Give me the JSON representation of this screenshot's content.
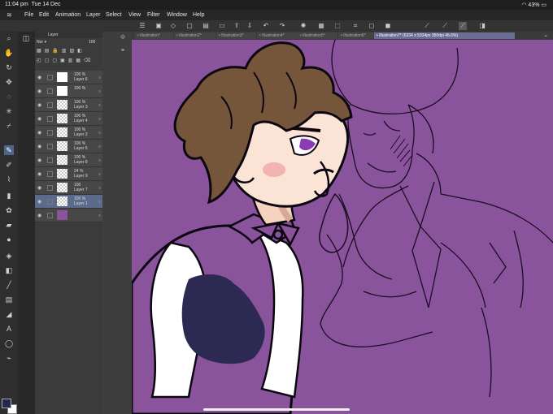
{
  "status_bar": {
    "time": "11:04 pm",
    "date": "Tue 14 Dec",
    "battery": "43%"
  },
  "menu": {
    "items": [
      "File",
      "Edit",
      "Animation",
      "Layer",
      "Select",
      "View",
      "Filter",
      "Window",
      "Help"
    ]
  },
  "tabs": [
    {
      "label": "Illustration*"
    },
    {
      "label": "Illustration2*"
    },
    {
      "label": "Illustration3*"
    },
    {
      "label": "Illustration4*"
    },
    {
      "label": "Illustration5*"
    },
    {
      "label": "Illustration6*"
    },
    {
      "label": "Illustration7* (6334 x 5334px 350dpi 46.6%)"
    }
  ],
  "layers_panel": {
    "title": "Layer",
    "blend": "Nor",
    "opacity": "100",
    "rows": [
      {
        "pct": "100 %",
        "name": "Layer 6",
        "thumb": "white"
      },
      {
        "pct": "100 %",
        "name": "",
        "thumb": "white"
      },
      {
        "pct": "100 %",
        "name": "Layer 3",
        "thumb": "checker"
      },
      {
        "pct": "100 %",
        "name": "Layer 4",
        "thumb": "checker"
      },
      {
        "pct": "100 %",
        "name": "Layer 2",
        "thumb": "checker"
      },
      {
        "pct": "100 %",
        "name": "Layer 5",
        "thumb": "checker"
      },
      {
        "pct": "100 %",
        "name": "Layer 8",
        "thumb": "checker"
      },
      {
        "pct": "24 %",
        "name": "Layer 9",
        "thumb": "checker"
      },
      {
        "pct": "100",
        "name": "Layer 7",
        "thumb": "checker"
      },
      {
        "pct": "100 %",
        "name": "Layer 1",
        "thumb": "checker",
        "selected": true
      },
      {
        "pct": "",
        "name": "",
        "thumb": "purple"
      }
    ]
  },
  "colors": {
    "canvas_bg": "#8a549c",
    "primary": "#25284e",
    "secondary": "#ffffff",
    "accent": "#5c6a8c"
  }
}
